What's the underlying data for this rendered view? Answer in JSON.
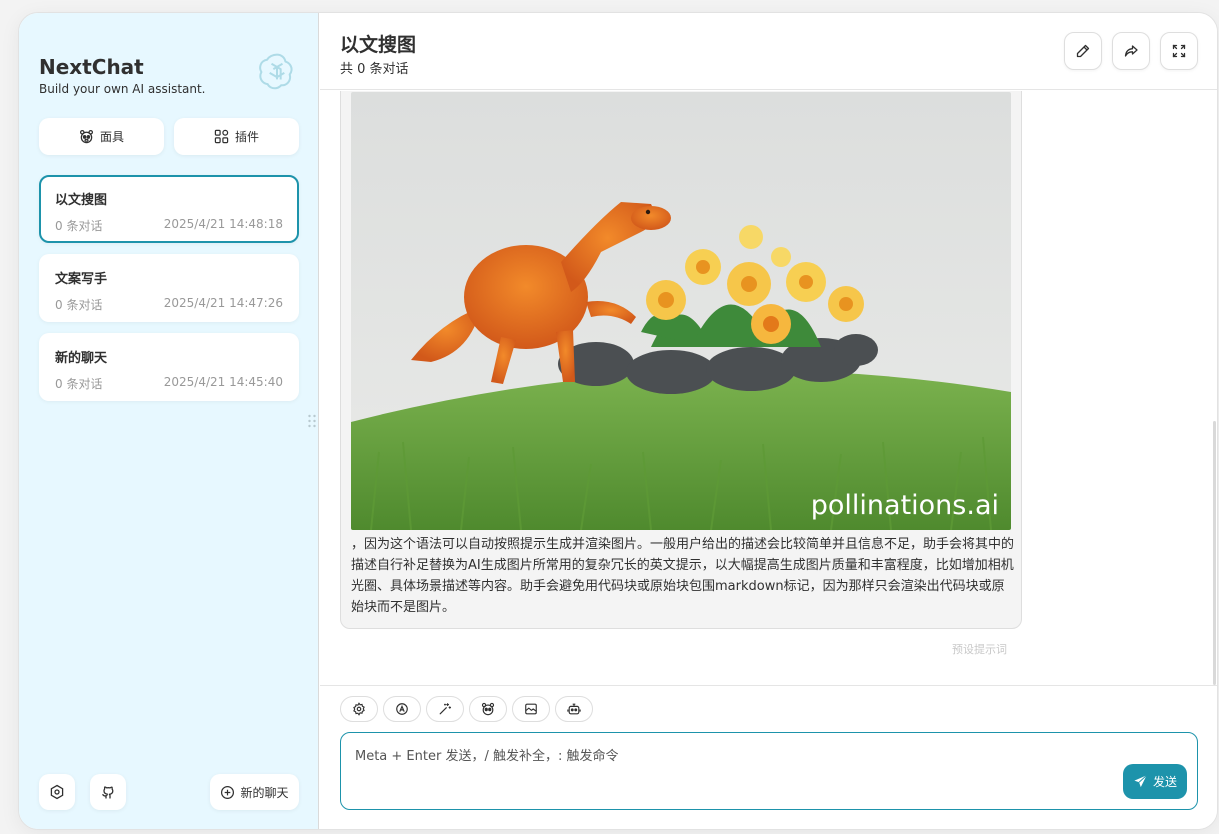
{
  "sidebar": {
    "brand_title": "NextChat",
    "brand_subtitle": "Build your own AI assistant.",
    "mask_button": "面具",
    "plugin_button": "插件",
    "chats": [
      {
        "title": "以文搜图",
        "count": "0 条对话",
        "date": "2025/4/21 14:48:18",
        "selected": true
      },
      {
        "title": "文案写手",
        "count": "0 条对话",
        "date": "2025/4/21 14:47:26",
        "selected": false
      },
      {
        "title": "新的聊天",
        "count": "0 条对话",
        "date": "2025/4/21 14:45:40",
        "selected": false
      }
    ],
    "new_chat_button": "新的聊天"
  },
  "header": {
    "title": "以文搜图",
    "subtitle": "共 0 条对话"
  },
  "message": {
    "image_watermark": "pollinations.ai",
    "text": "，因为这个语法可以自动按照提示生成并渲染图片。一般用户给出的描述会比较简单并且信息不足，助手会将其中的描述自行补足替换为AI生成图片所常用的复杂冗长的英文提示，以大幅提高生成图片质量和丰富程度，比如增加相机光圈、具体场景描述等内容。助手会避免用代码块或原始块包围markdown标记，因为那样只会渲染出代码块或原始块而不是图片。",
    "tag": "预设提示词"
  },
  "input": {
    "placeholder": "Meta + Enter 发送，/ 触发补全，: 触发命令",
    "value": "",
    "send_label": "发送"
  },
  "icons": {
    "chat_settings": "settings-icon",
    "theme": "auto-theme-icon",
    "prompt": "magic-wand-icon",
    "mask": "mask-icon",
    "image": "image-icon",
    "bot": "robot-icon"
  },
  "colors": {
    "accent": "#1d93ab",
    "sidebar_bg": "#e7f8ff",
    "bubble_bg": "#f4f4f4"
  }
}
